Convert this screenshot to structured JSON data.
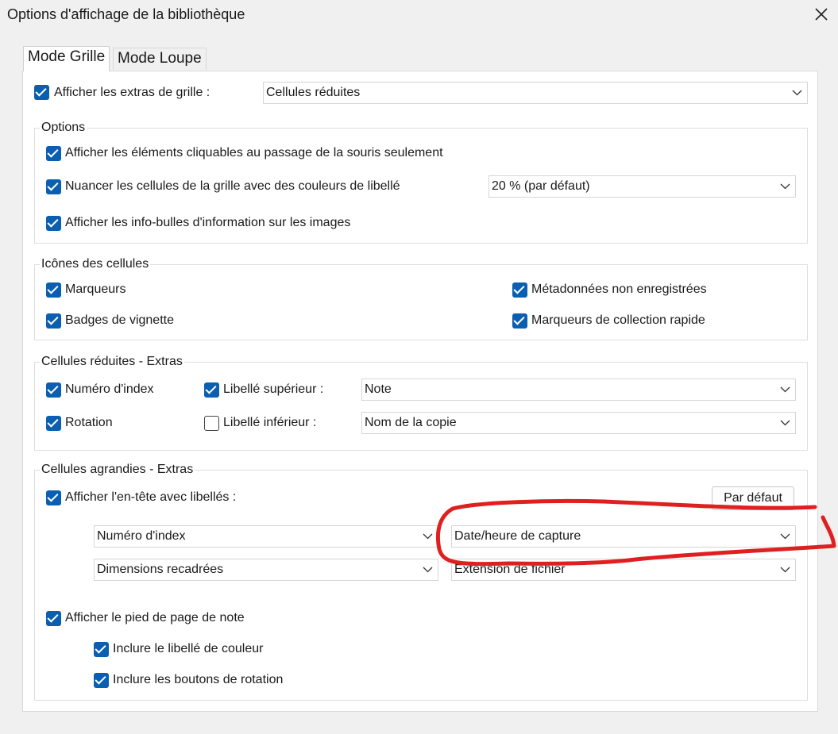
{
  "window": {
    "title": "Options d'affichage de la bibliothèque",
    "close_icon": "close-icon"
  },
  "tabs": [
    {
      "label": "Mode Grille",
      "active": true
    },
    {
      "label": "Mode Loupe",
      "active": false
    }
  ],
  "grid_extras": {
    "label": "Afficher les extras de grille :",
    "checked": true,
    "value": "Cellules réduites"
  },
  "options": {
    "title": "Options",
    "clickable_label": "Afficher les éléments cliquables au passage de la souris seulement",
    "tint_label": "Nuancer les cellules de la grille avec des couleurs de libellé",
    "tint_value": "20 % (par défaut)",
    "tooltips_label": "Afficher les info-bulles d'information sur les images"
  },
  "cell_icons": {
    "title": "Icônes des cellules",
    "flags": "Marqueurs",
    "thumbnail_badges": "Badges de vignette",
    "unsaved_metadata": "Métadonnées non enregistrées",
    "quick_collection": "Marqueurs de collection rapide"
  },
  "compact": {
    "title": "Cellules réduites - Extras",
    "index_number": "Numéro d'index",
    "rotation": "Rotation",
    "top_label": "Libellé supérieur :",
    "top_value": "Note",
    "bottom_label": "Libellé inférieur :",
    "bottom_checked": false,
    "bottom_value": "Nom de la copie"
  },
  "expanded": {
    "title": "Cellules agrandies - Extras",
    "header_label": "Afficher l'en-tête avec libellés :",
    "default_button": "Par défaut",
    "selects": [
      "Numéro d'index",
      "Date/heure de capture",
      "Dimensions recadrées",
      "Extension de fichier"
    ],
    "footer_label": "Afficher le pied de page de note",
    "color_label": "Inclure le libellé de couleur",
    "rotation_buttons": "Inclure les boutons de rotation"
  },
  "colors": {
    "accent": "#0a5fb0",
    "annotation": "#e02020"
  }
}
